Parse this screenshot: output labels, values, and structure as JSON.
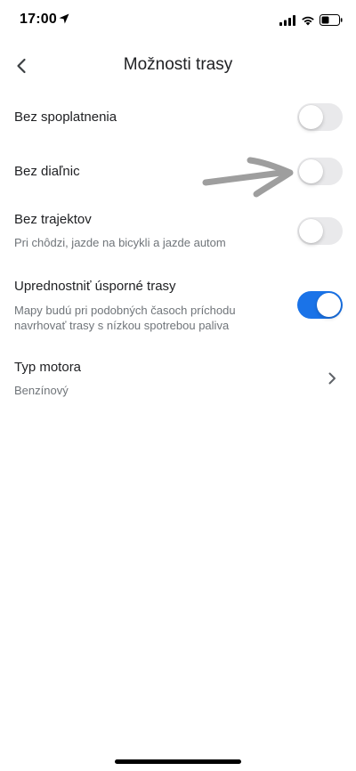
{
  "status_bar": {
    "time": "17:00",
    "icons": [
      "location-arrow-icon",
      "cellular-signal-icon",
      "wifi-icon",
      "battery-icon"
    ]
  },
  "header": {
    "title": "Možnosti trasy",
    "back_icon": "chevron-left-icon"
  },
  "settings": [
    {
      "title": "Bez spoplatnenia",
      "subtitle": "",
      "control": "toggle",
      "enabled": false
    },
    {
      "title": "Bez diaľnic",
      "subtitle": "",
      "control": "toggle",
      "enabled": false
    },
    {
      "title": "Bez trajektov",
      "subtitle": "Pri chôdzi, jazde na bicykli a jazde autom",
      "control": "toggle",
      "enabled": false
    },
    {
      "title": "Uprednostniť úsporné trasy",
      "subtitle": "Mapy budú pri podobných časoch príchodu navrhovať trasy s nízkou spotrebou paliva",
      "control": "toggle",
      "enabled": true
    },
    {
      "title": "Typ motora",
      "subtitle": "Benzínový",
      "control": "chevron-right-icon"
    }
  ],
  "colors": {
    "accent": "#1a73e8",
    "toggle_off": "#e9e9eb",
    "subtitle": "#70757a",
    "annotation_arrow": "#9e9e9e"
  }
}
